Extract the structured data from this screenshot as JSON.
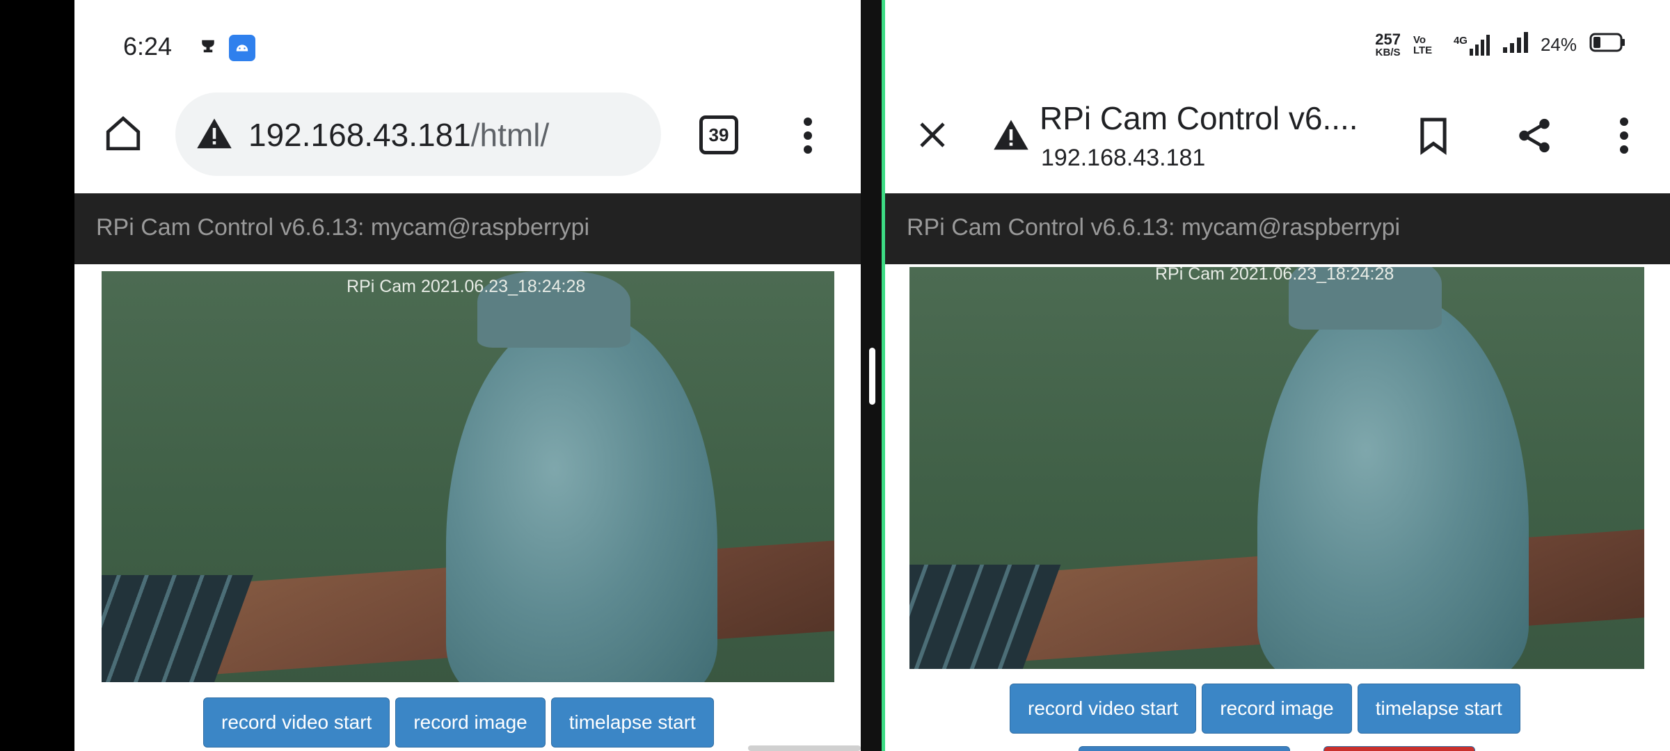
{
  "status_bar": {
    "time": "6:24",
    "data_rate": "257",
    "data_rate_unit": "KB/S",
    "volte": "Vo LTE",
    "network": "4G",
    "battery": "24%"
  },
  "left": {
    "url_host": "192.168.43.181",
    "url_path": "/html/",
    "tab_count": "39",
    "app_title": "RPi Cam Control v6.6.13: mycam@raspberrypi",
    "cam_stamp": "RPi Cam  2021.06.23_18:24:28",
    "buttons": [
      "record video start",
      "record image",
      "timelapse start"
    ]
  },
  "right": {
    "page_title": "RPi Cam Control v6....",
    "page_host": "192.168.43.181",
    "app_title": "RPi Cam Control v6.6.13: mycam@raspberrypi",
    "cam_stamp": "RPi Cam  2021.06.23_18:24:28",
    "buttons": [
      "record video start",
      "record image",
      "timelapse start"
    ]
  },
  "colors": {
    "button_blue": "#3b86c6",
    "app_bar": "#222222",
    "split_accent": "#3ddc84"
  }
}
